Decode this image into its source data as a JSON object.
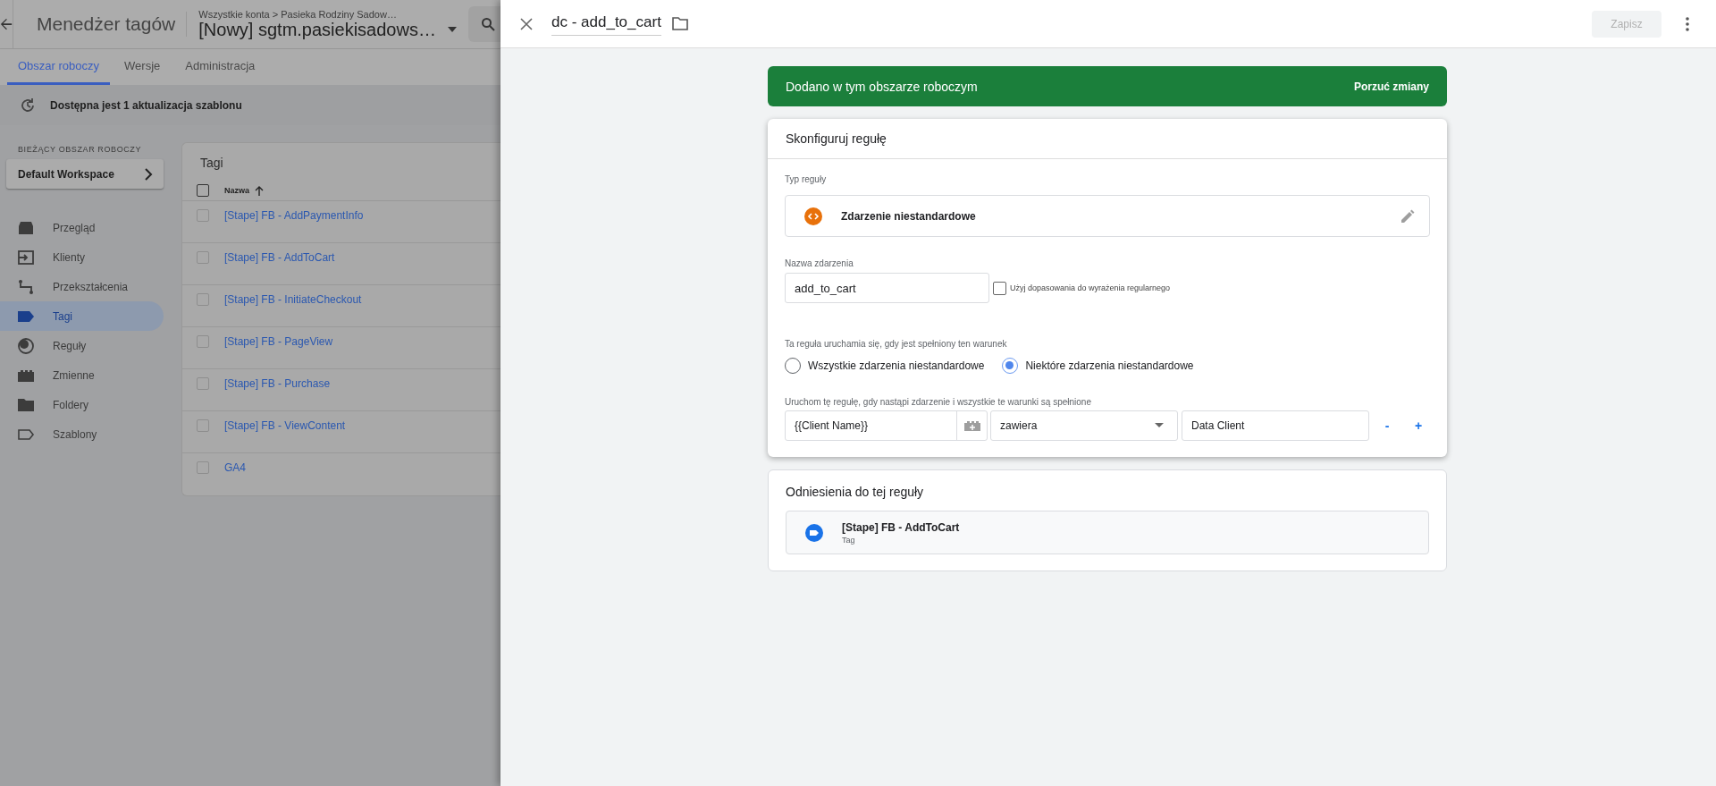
{
  "app_header": {
    "product": "Menedżer tagów",
    "breadcrumb": "Wszystkie konta > Pasieka Rodziny Sadow…",
    "container": "[Nowy] sgtm.pasiekisadows…"
  },
  "nav_tabs": [
    {
      "label": "Obszar roboczy",
      "selected": true
    },
    {
      "label": "Wersje",
      "selected": false
    },
    {
      "label": "Administracja",
      "selected": false
    }
  ],
  "update_notice": "Dostępna jest 1 aktualizacja szablonu",
  "workspace": {
    "heading": "BIEŻĄCY OBSZAR ROBOCZY",
    "name": "Default Workspace"
  },
  "sidebar": {
    "items": [
      {
        "label": "Przegląd",
        "selected": false
      },
      {
        "label": "Klienty",
        "selected": false
      },
      {
        "label": "Przekształcenia",
        "selected": false
      },
      {
        "label": "Tagi",
        "selected": true
      },
      {
        "label": "Reguły",
        "selected": false
      },
      {
        "label": "Zmienne",
        "selected": false
      },
      {
        "label": "Foldery",
        "selected": false
      },
      {
        "label": "Szablony",
        "selected": false
      }
    ]
  },
  "tags_table": {
    "title": "Tagi",
    "select_all_checked": false,
    "columns": [
      {
        "label": "Nazwa",
        "sort_ascending": true
      }
    ],
    "rows": [
      {
        "name": "[Stape] FB - AddPaymentInfo",
        "checked": false
      },
      {
        "name": "[Stape] FB - AddToCart",
        "checked": false
      },
      {
        "name": "[Stape] FB - InitiateCheckout",
        "checked": false
      },
      {
        "name": "[Stape] FB - PageView",
        "checked": false
      },
      {
        "name": "[Stape] FB - Purchase",
        "checked": false
      },
      {
        "name": "[Stape] FB - ViewContent",
        "checked": false
      },
      {
        "name": "GA4",
        "checked": false
      }
    ]
  },
  "panel": {
    "title": "dc - add_to_cart",
    "save_button": {
      "label": "Zapisz",
      "disabled": true
    }
  },
  "status_banner": {
    "text": "Dodano w tym obszarze roboczym",
    "action": "Porzuć zmiany"
  },
  "config_card": {
    "title": "Skonfiguruj regułę",
    "type_label": "Typ reguły",
    "type_name": "Zdarzenie niestandardowe",
    "event_name_label": "Nazwa zdarzenia",
    "event_name_value": "add_to_cart",
    "regex": {
      "label": "Użyj dopasowania do wyrażenia regularnego",
      "checked": false
    },
    "fires_label": "Ta reguła uruchamia się, gdy jest spełniony ten warunek",
    "fire_options": [
      {
        "label": "Wszystkie zdarzenia niestandardowe",
        "selected": false
      },
      {
        "label": "Niektóre zdarzenia niestandardowe",
        "selected": true
      }
    ],
    "conditions_label": "Uruchom tę regułę, gdy nastąpi zdarzenie i wszystkie te warunki są spełnione",
    "conditions": [
      {
        "variable": "{{Client Name}}",
        "operator": "zawiera",
        "value": "Data Client",
        "remove": "-",
        "add": "+"
      }
    ]
  },
  "references": {
    "title": "Odniesienia do tej reguły",
    "items": [
      {
        "name": "[Stape] FB - AddToCart",
        "type": "Tag"
      }
    ]
  }
}
